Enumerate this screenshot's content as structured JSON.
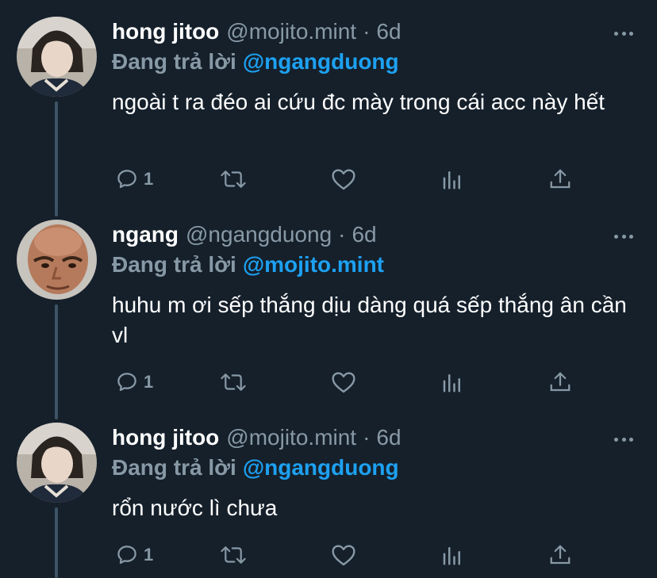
{
  "reply_prefix": "Đang trả lời",
  "colors": {
    "background": "#15202b",
    "secondary_text": "#8899a6",
    "link": "#1da1f2",
    "thread_line": "#3d5466"
  },
  "tweets": [
    {
      "name": "hong jitoo",
      "handle": "@mojito.mint",
      "separator": "·",
      "time": "6d",
      "reply_to": "@ngangduong",
      "text": "ngoài t ra đéo ai cứu đc mày trong cái acc này hết",
      "reply_count": "1",
      "avatar": "profile-photo-hong-jitoo"
    },
    {
      "name": "ngang",
      "handle": "@ngangduong",
      "separator": "·",
      "time": "6d",
      "reply_to": "@mojito.mint",
      "text": "huhu m ơi sếp thắng dịu dàng quá sếp thắng ân cần vl",
      "reply_count": "1",
      "avatar": "profile-photo-ngang"
    },
    {
      "name": "hong jitoo",
      "handle": "@mojito.mint",
      "separator": "·",
      "time": "6d",
      "reply_to": "@ngangduong",
      "text": "rổn nước lì chưa",
      "reply_count": "1",
      "avatar": "profile-photo-hong-jitoo"
    }
  ],
  "icons": {
    "reply": "reply-icon",
    "retweet": "retweet-icon",
    "like": "heart-icon",
    "analytics": "analytics-icon",
    "share": "share-icon",
    "more": "more-icon"
  }
}
